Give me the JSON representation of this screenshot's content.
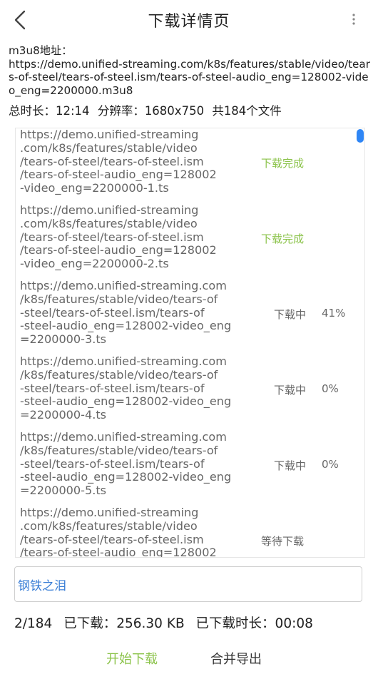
{
  "header": {
    "title": "下载详情页",
    "back_icon": "chevron-left-icon",
    "more_icon": "more-vertical-icon"
  },
  "m3u8": {
    "label": "m3u8地址：",
    "url": "https://demo.unified-streaming.com/k8s/features/stable/video/tears-of-steel/tears-of-steel.ism/tears-of-steel-audio_eng=128002-video_eng=2200000.m3u8"
  },
  "summary": {
    "duration": "总时长：12:14",
    "resolution": "分辨率：1680x750",
    "file_count": "共184个文件"
  },
  "items": [
    {
      "url": "https://demo.unified-streaming\n.com/k8s/features/stable/video\n/tears-of-steel/tears-of-steel.ism\n/tears-of-steel-audio_eng=128002\n-video_eng=2200000-1.ts",
      "status": "下载完成",
      "percent": ""
    },
    {
      "url": "https://demo.unified-streaming\n.com/k8s/features/stable/video\n/tears-of-steel/tears-of-steel.ism\n/tears-of-steel-audio_eng=128002\n-video_eng=2200000-2.ts",
      "status": "下载完成",
      "percent": ""
    },
    {
      "url": "https://demo.unified-streaming.com\n/k8s/features/stable/video/tears-of\n-steel/tears-of-steel.ism/tears-of\n-steel-audio_eng=128002-video_eng\n=2200000-3.ts",
      "status": "下载中",
      "percent": "41%"
    },
    {
      "url": "https://demo.unified-streaming.com\n/k8s/features/stable/video/tears-of\n-steel/tears-of-steel.ism/tears-of\n-steel-audio_eng=128002-video_eng\n=2200000-4.ts",
      "status": "下载中",
      "percent": "0%"
    },
    {
      "url": "https://demo.unified-streaming.com\n/k8s/features/stable/video/tears-of\n-steel/tears-of-steel.ism/tears-of\n-steel-audio_eng=128002-video_eng\n=2200000-5.ts",
      "status": "下载中",
      "percent": "0%"
    },
    {
      "url": "https://demo.unified-streaming\n.com/k8s/features/stable/video\n/tears-of-steel/tears-of-steel.ism\n/tears-of-steel-audio_eng=128002",
      "status": "等待下载",
      "percent": ""
    }
  ],
  "name_field": {
    "value": "钢铁之泪"
  },
  "progress": {
    "count": "2/184",
    "downloaded": "已下载：256.30 KB",
    "elapsed": "已下载时长：00:08"
  },
  "actions": {
    "start_label": "开始下载",
    "merge_label": "合并导出"
  },
  "colors": {
    "accent_green": "#8bc34a",
    "scroll_blue": "#2f86f5",
    "input_text_blue": "#3b7fd6"
  }
}
